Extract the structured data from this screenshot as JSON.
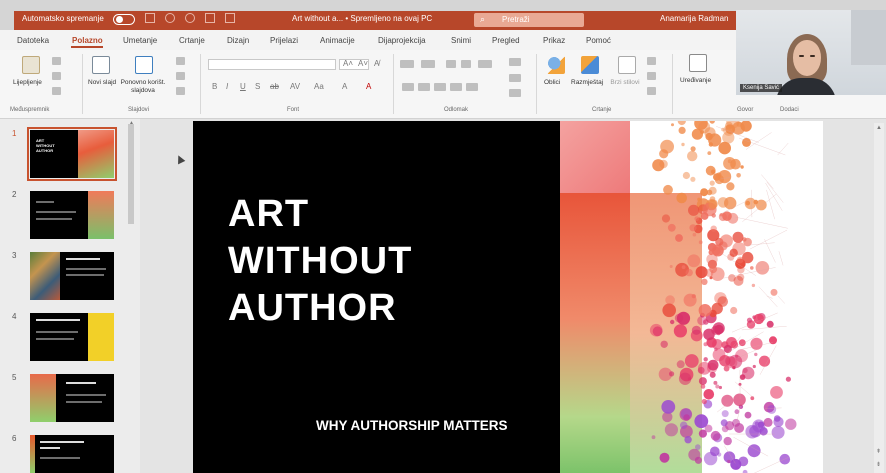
{
  "titlebar": {
    "autosave_label": "Automatsko spremanje",
    "doc_title": "Art without a... • Spremljeno na ovaj PC",
    "search_placeholder": "Pretraži",
    "user_name": "Anamarija Radman",
    "accent_color": "#b7472a"
  },
  "tabs": [
    "Datoteka",
    "Polazno",
    "Umetanje",
    "Crtanje",
    "Dizajn",
    "Prijelazi",
    "Animacije",
    "Dijaprojekcija",
    "Snimi",
    "Pregled",
    "Prikaz",
    "Pomoć"
  ],
  "active_tab": "Polazno",
  "ribbon": {
    "groups": [
      "Međuspremnik",
      "Slajdovi",
      "Font",
      "Odlomak",
      "Crtanje",
      "Govor",
      "Dodaci"
    ],
    "paste_label": "Lijepljenje",
    "new_slide_label": "Novi slajd",
    "reuse_label": "Ponovno korišt. slajdova",
    "shapes_label": "Oblici",
    "arrange_label": "Razmještaj",
    "quick_styles_label": "Brzi stilovi",
    "editing_label": "Uređivanje",
    "font_buttons": [
      "B",
      "I",
      "U",
      "S",
      "ab",
      "AV",
      "Aa",
      "A",
      "A"
    ]
  },
  "webcam": {
    "participant_name": "Ksenija Savić"
  },
  "thumbnails": [
    {
      "number": "1",
      "title": "ART WITHOUT AUTHOR",
      "selected": true
    },
    {
      "number": "2",
      "title": "",
      "selected": false
    },
    {
      "number": "3",
      "title": "",
      "selected": false
    },
    {
      "number": "4",
      "title": "",
      "selected": false
    },
    {
      "number": "5",
      "title": "",
      "selected": false
    },
    {
      "number": "6",
      "title": "",
      "selected": false
    }
  ],
  "slide": {
    "title_lines": [
      "ART",
      "WITHOUT",
      "AUTHOR"
    ],
    "subtitle": "WHY AUTHORSHIP MATTERS"
  }
}
